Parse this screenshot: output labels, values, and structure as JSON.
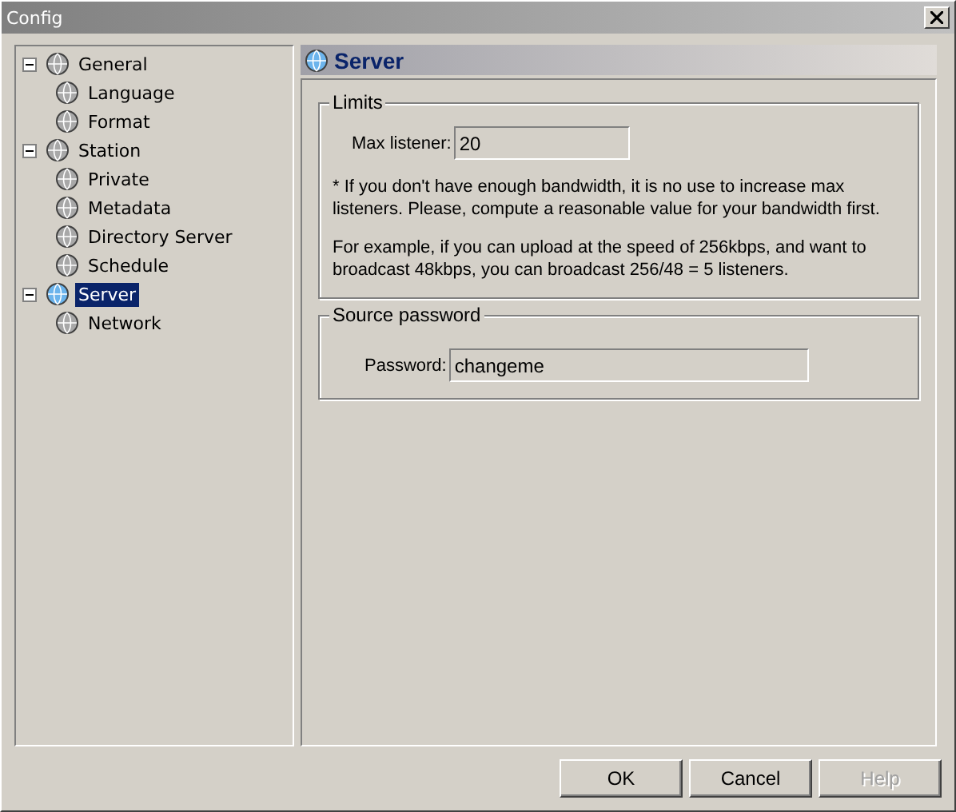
{
  "window": {
    "title": "Config"
  },
  "tree": [
    {
      "label": "General",
      "selected": false,
      "expanded": true,
      "children": [
        {
          "label": "Language",
          "selected": false
        },
        {
          "label": "Format",
          "selected": false
        }
      ]
    },
    {
      "label": "Station",
      "selected": false,
      "expanded": true,
      "children": [
        {
          "label": "Private",
          "selected": false
        },
        {
          "label": "Metadata",
          "selected": false
        },
        {
          "label": "Directory Server",
          "selected": false
        },
        {
          "label": "Schedule",
          "selected": false
        }
      ]
    },
    {
      "label": "Server",
      "selected": true,
      "expanded": true,
      "children": [
        {
          "label": "Network",
          "selected": false
        }
      ]
    }
  ],
  "page": {
    "title": "Server"
  },
  "groups": [
    {
      "title": "Limits",
      "field": {
        "label": "Max listener:",
        "value": "20"
      },
      "notes": [
        "* If you don't have enough bandwidth, it is no use to increase max listeners. Please, compute a reasonable value for your bandwidth first.",
        "For example, if you can upload at the speed of 256kbps, and want to broadcast 48kbps, you can broadcast 256/48 = 5 listeners."
      ]
    },
    {
      "title": "Source password",
      "field": {
        "label": "Password:",
        "value": "changeme"
      }
    }
  ],
  "buttons": [
    {
      "label": "OK",
      "disabled": false
    },
    {
      "label": "Cancel",
      "disabled": false
    },
    {
      "label": "Help",
      "disabled": true
    }
  ]
}
